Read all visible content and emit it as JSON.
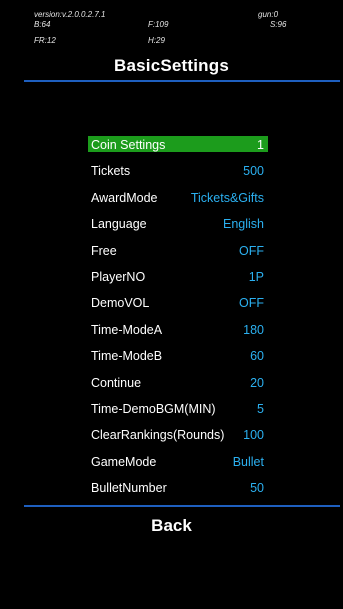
{
  "debug": {
    "version": "version:v.2.0.0.2.7.1",
    "gun": "gun:0",
    "b": "B:64",
    "f": "F:109",
    "s": "S:96",
    "fr": "FR:12",
    "h": "H:29"
  },
  "title": "BasicSettings",
  "settings": [
    {
      "label": "Coin Settings",
      "value": "1",
      "selected": true
    },
    {
      "label": "Tickets",
      "value": "500"
    },
    {
      "label": "AwardMode",
      "value": "Tickets&Gifts"
    },
    {
      "label": "Language",
      "value": "English"
    },
    {
      "label": "Free",
      "value": "OFF"
    },
    {
      "label": "PlayerNO",
      "value": "1P"
    },
    {
      "label": "DemoVOL",
      "value": "OFF"
    },
    {
      "label": "Time-ModeA",
      "value": "180"
    },
    {
      "label": "Time-ModeB",
      "value": "60"
    },
    {
      "label": "Continue",
      "value": "20"
    },
    {
      "label": "Time-DemoBGM(MIN)",
      "value": "5"
    },
    {
      "label": "ClearRankings(Rounds)",
      "value": "100"
    },
    {
      "label": "GameMode",
      "value": "Bullet"
    },
    {
      "label": "BulletNumber",
      "value": "50"
    }
  ],
  "back_label": "Back",
  "colors": {
    "background": "#000000",
    "divider": "#1e5fbf",
    "value_text": "#2bb0f0",
    "selection_highlight": "#1c9c1c"
  }
}
